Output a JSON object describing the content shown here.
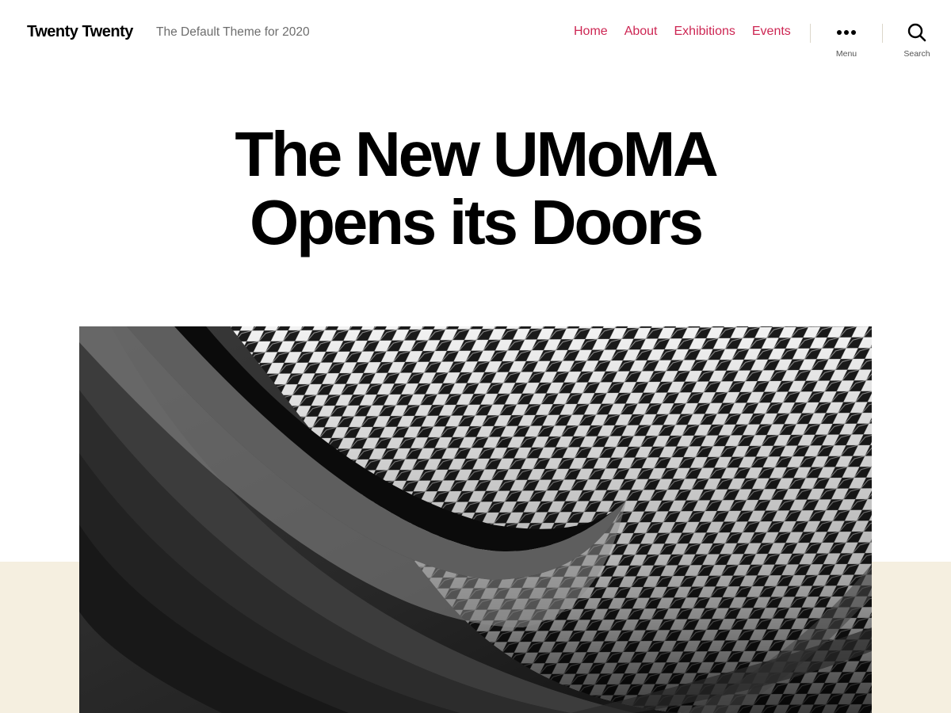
{
  "site": {
    "title": "Twenty Twenty",
    "description": "The Default Theme for 2020"
  },
  "nav": {
    "items": [
      {
        "label": "Home"
      },
      {
        "label": "About"
      },
      {
        "label": "Exhibitions"
      },
      {
        "label": "Events"
      }
    ]
  },
  "toggles": {
    "menu_label": "Menu",
    "search_label": "Search"
  },
  "post": {
    "title_line1": "The New UMoMA",
    "title_line2": "Opens its Doors"
  },
  "colors": {
    "accent": "#cd2653",
    "text": "#000000",
    "secondary_text": "#6d6d6d",
    "background": "#ffffff",
    "band": "#f5efe0",
    "separator": "#dcd7ca"
  },
  "icons": {
    "menu": "ellipsis-icon",
    "search": "search-icon"
  }
}
